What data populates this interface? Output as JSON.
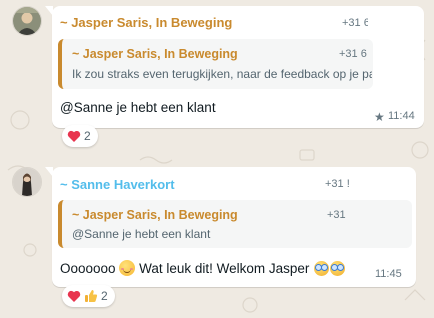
{
  "messages": [
    {
      "sender": "~ Jasper Saris, In Beweging",
      "sender_color": "#c98a2e",
      "phone": "+31 6",
      "quote": {
        "sender": "~ Jasper Saris, In Beweging",
        "phone": "+31 6",
        "text": "Ik zou straks even terugkijken, naar de feedback op je pagina"
      },
      "text": "@Sanne je hebt een klant",
      "time": "11:44",
      "starred": true,
      "reactions": {
        "count": "2"
      }
    },
    {
      "sender": "~ Sanne Haverkort",
      "sender_color": "#53bdeb",
      "phone": "+31 !",
      "quote": {
        "sender": "~ Jasper Saris, In Beweging",
        "phone": "+31",
        "text": "@Sanne je hebt een klant"
      },
      "text_parts": [
        "Ooooooo",
        "Wat leuk dit! Welkom Jasper"
      ],
      "time": "11:45",
      "reactions": {
        "count": "2"
      }
    }
  ],
  "icons": [
    "heart-icon",
    "star-icon",
    "thumbs-up-icon",
    "smiling-face-icon",
    "goggles-face-icon"
  ]
}
